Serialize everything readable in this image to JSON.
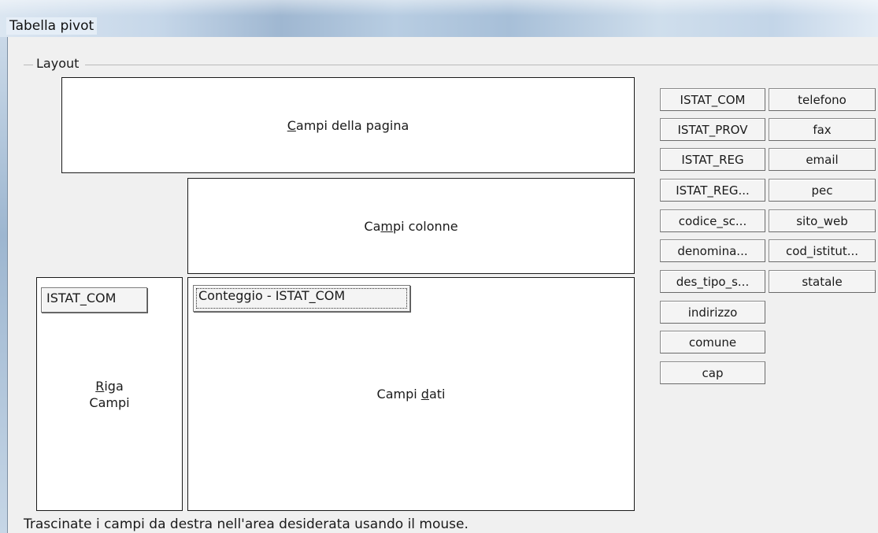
{
  "window": {
    "title": "Tabella pivot"
  },
  "layout_group": {
    "label": "Layout"
  },
  "zones": {
    "page_fields": {
      "pre": "",
      "mnemonic": "C",
      "post": "ampi della pagina"
    },
    "column_fields": {
      "pre": "Ca",
      "mnemonic": "m",
      "post": "pi colonne"
    },
    "row_fields": {
      "line1_mnemonic": "R",
      "line1_rest": "iga",
      "line2": "Campi"
    },
    "data_fields": {
      "pre": "Campi ",
      "mnemonic": "d",
      "post": "ati"
    }
  },
  "placed_fields": {
    "row_field": "ISTAT_COM",
    "data_field": "Conteggio - ISTAT_COM"
  },
  "available_fields": [
    "ISTAT_COM",
    "ISTAT_PROV",
    "ISTAT_REG",
    "ISTAT_REG...",
    "codice_sc...",
    "denomina...",
    "des_tipo_s...",
    "indirizzo",
    "comune",
    "cap",
    "telefono",
    "fax",
    "email",
    "pec",
    "sito_web",
    "cod_istitut...",
    "statale"
  ],
  "hint": "Trascinate i campi da destra nell'area desiderata usando il mouse."
}
